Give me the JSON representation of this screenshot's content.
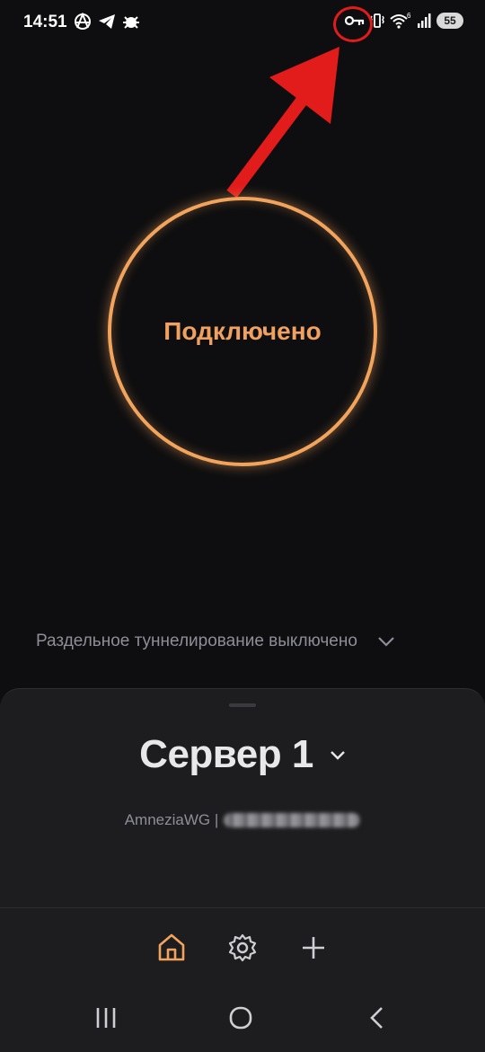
{
  "status_bar": {
    "time": "14:51",
    "left_icons": [
      "anarchy-icon",
      "telegram-icon",
      "bug-icon"
    ],
    "right_icons": [
      "vpn-key-icon",
      "vibrate-icon",
      "wifi-6-icon",
      "signal-icon"
    ],
    "battery": "55"
  },
  "annotation": {
    "color": "#e21b1b",
    "target": "vpn-key-icon"
  },
  "connect": {
    "label": "Подключено",
    "accent": "#f2a35c"
  },
  "split_tunneling": {
    "label": "Раздельное туннелирование выключено"
  },
  "server": {
    "name": "Сервер 1",
    "protocol": "AmneziaWG |"
  },
  "tabs": [
    {
      "icon": "home-icon",
      "active": true
    },
    {
      "icon": "gear-icon",
      "active": false
    },
    {
      "icon": "plus-icon",
      "active": false
    }
  ],
  "nav": [
    "recent-apps-icon",
    "home-circle-icon",
    "back-icon"
  ],
  "colors": {
    "background": "#0e0e10",
    "sheet": "#1d1d20",
    "accent": "#f2a35c",
    "muted": "#8e8e96"
  }
}
